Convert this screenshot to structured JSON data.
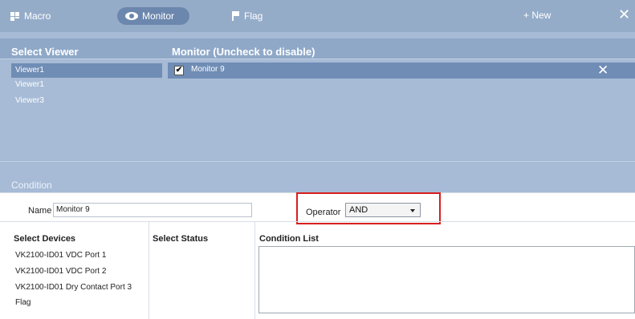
{
  "toolbar": {
    "tabs": [
      {
        "label": "Macro",
        "icon": "macro-icon"
      },
      {
        "label": "Monitor",
        "icon": "eye-icon"
      },
      {
        "label": "Flag",
        "icon": "flag-icon"
      }
    ],
    "new_label": "+ New",
    "close_glyph": "✕"
  },
  "viewer_panel": {
    "title": "Select Viewer",
    "items": [
      "Viewer1",
      "Viewer1",
      "Viewer3"
    ],
    "selected_index": 0
  },
  "monitor_panel": {
    "title": "Monitor (Uncheck to disable)",
    "items": [
      {
        "label": "Monitor 9",
        "checked": true,
        "check_glyph": "✔",
        "remove_glyph": "✕"
      }
    ]
  },
  "condition": {
    "section_label": "Condition",
    "name_label": "Name",
    "name_value": "Monitor 9",
    "operator_label": "Operator",
    "operator_value": "AND",
    "select_devices_label": "Select Devices",
    "devices": [
      "VK2100-ID01 VDC Port 1",
      "VK2100-ID01 VDC Port 2",
      "VK2100-ID01 Dry Contact Port 3",
      "Flag"
    ],
    "select_status_label": "Select Status",
    "condition_list_label": "Condition List"
  },
  "colors": {
    "topbar": "#95acc9",
    "panel": "#a7bbd6",
    "selected_row": "#6f8db5",
    "highlight": "#d81e1e"
  }
}
